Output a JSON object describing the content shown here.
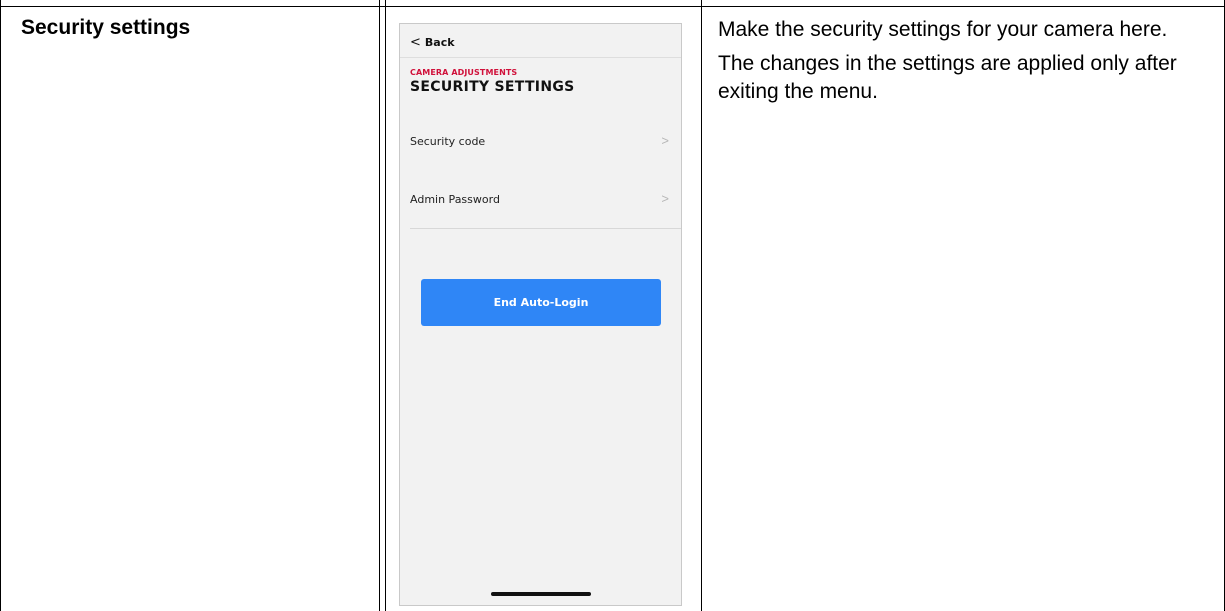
{
  "document": {
    "section_title": "Security settings",
    "description": [
      "Make the security settings for your camera here.",
      "The changes in the settings are applied only after exiting the menu."
    ]
  },
  "phone": {
    "back_label": "Back",
    "back_chevron": "<",
    "subtitle": "CAMERA ADJUSTMENTS",
    "title": "SECURITY SETTINGS",
    "items": [
      {
        "label": "Security code",
        "arrow": ">"
      },
      {
        "label": "Admin Password",
        "arrow": ">"
      }
    ],
    "button_label": "End Auto-Login",
    "colors": {
      "accent": "#d0103a",
      "button": "#2f86f6"
    }
  }
}
